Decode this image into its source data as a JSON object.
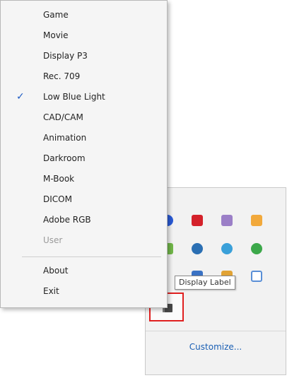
{
  "context_menu": {
    "items": [
      {
        "label": "Game",
        "checked": false,
        "enabled": true
      },
      {
        "label": "Movie",
        "checked": false,
        "enabled": true
      },
      {
        "label": "Display P3",
        "checked": false,
        "enabled": true
      },
      {
        "label": "Rec. 709",
        "checked": false,
        "enabled": true
      },
      {
        "label": "Low Blue Light",
        "checked": true,
        "enabled": true
      },
      {
        "label": "CAD/CAM",
        "checked": false,
        "enabled": true
      },
      {
        "label": "Animation",
        "checked": false,
        "enabled": true
      },
      {
        "label": "Darkroom",
        "checked": false,
        "enabled": true
      },
      {
        "label": "M-Book",
        "checked": false,
        "enabled": true
      },
      {
        "label": "DICOM",
        "checked": false,
        "enabled": true
      },
      {
        "label": "Adobe RGB",
        "checked": false,
        "enabled": true
      },
      {
        "label": "User",
        "checked": false,
        "enabled": false
      },
      {
        "label": "About",
        "checked": false,
        "enabled": true
      },
      {
        "label": "Exit",
        "checked": false,
        "enabled": true
      }
    ],
    "check_glyph": "✓"
  },
  "tray_flyout": {
    "tooltip": "Display Label",
    "customize_label": "Customize...",
    "icons": [
      {
        "name": "bluetooth-icon",
        "color": "#2a5bd7"
      },
      {
        "name": "adobe-icon",
        "color": "#d4212a"
      },
      {
        "name": "onenote-icon",
        "color": "#9b7fc7"
      },
      {
        "name": "folder-icon",
        "color": "#f2a93b"
      },
      {
        "name": "check-icon",
        "color": "#72b84a"
      },
      {
        "name": "network-icon",
        "color": "#2b6fb3"
      },
      {
        "name": "globe-icon",
        "color": "#3aa0d9"
      },
      {
        "name": "sync-icon",
        "color": "#3ca84a"
      },
      {
        "name": "shield-icon",
        "color": "#3a72c4"
      },
      {
        "name": "box-icon",
        "color": "#e1a335"
      },
      {
        "name": "square-icon",
        "color": "#5a8fd6"
      }
    ],
    "selected_icon": {
      "name": "display-app-icon",
      "color": "#4a4a4a"
    }
  },
  "colors": {
    "highlight_border": "#e02020",
    "link": "#1a5fb4"
  }
}
